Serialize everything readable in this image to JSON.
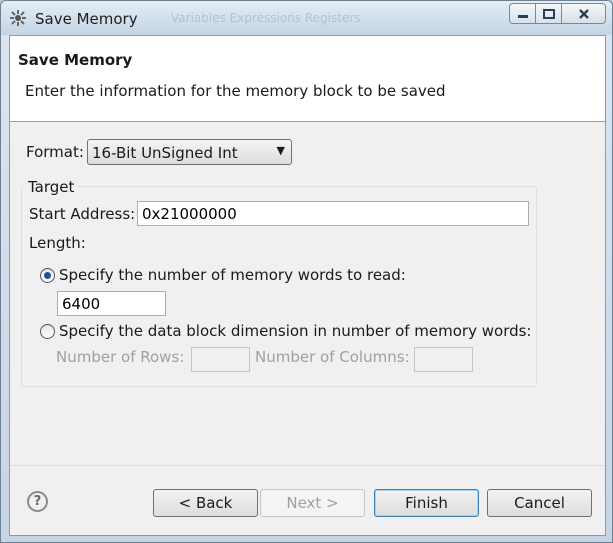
{
  "window": {
    "title": "Save Memory",
    "background_tabs": "Variables   Expressions   Registers"
  },
  "header": {
    "title": "Save Memory",
    "message": "Enter the information for the memory block to be saved"
  },
  "form": {
    "format_label": "Format:",
    "format_value": "16-Bit UnSigned Int",
    "group_title": "Target",
    "start_address_label": "Start Address:",
    "start_address_value": "0x21000000",
    "length_label": "Length:",
    "option_words_label": "Specify the number of memory words to read:",
    "option_words_checked": true,
    "words_value": "6400",
    "option_dimension_label": "Specify the data block dimension in number of memory words:",
    "option_dimension_checked": false,
    "rows_label": "Number of Rows:",
    "rows_value": "",
    "columns_label": "Number of Columns:",
    "columns_value": ""
  },
  "buttons": {
    "back": "< Back",
    "next": "Next >",
    "finish": "Finish",
    "cancel": "Cancel",
    "help": "?"
  },
  "icons": [
    "app-icon",
    "minimize-icon",
    "maximize-icon",
    "close-icon",
    "chevron-down-icon",
    "help-icon"
  ]
}
